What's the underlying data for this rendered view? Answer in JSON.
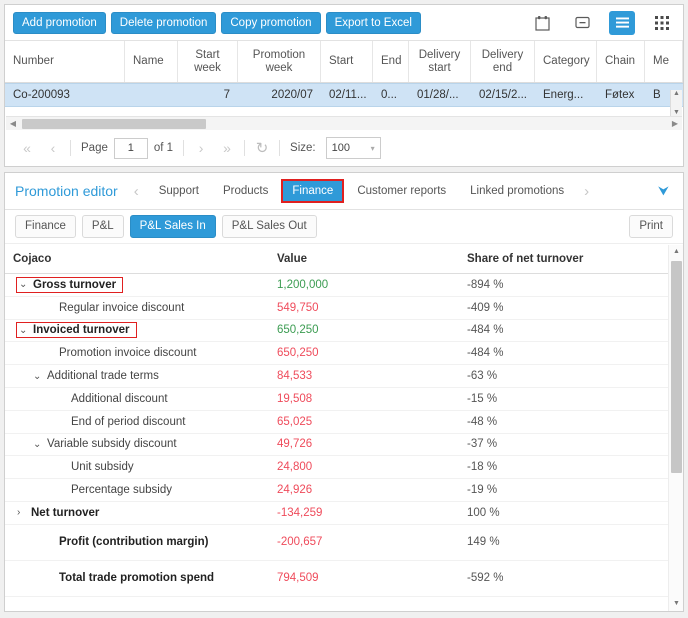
{
  "toolbar": {
    "buttons": [
      {
        "label": "Add promotion",
        "name": "add-promotion-button"
      },
      {
        "label": "Delete promotion",
        "name": "delete-promotion-button"
      },
      {
        "label": "Copy promotion",
        "name": "copy-promotion-button"
      },
      {
        "label": "Export to Excel",
        "name": "export-to-excel-button"
      }
    ],
    "icons": [
      {
        "name": "calendar-icon"
      },
      {
        "name": "collapse-box-icon"
      },
      {
        "name": "list-view-icon",
        "active": true
      },
      {
        "name": "grid-view-icon"
      }
    ]
  },
  "grid": {
    "columns": [
      "Number",
      "Name",
      "Start week",
      "Promotion week",
      "Start",
      "End",
      "Delivery start",
      "Delivery end",
      "Category",
      "Chain",
      "Me"
    ],
    "column_lines": [
      [
        "Number"
      ],
      [
        "Name"
      ],
      [
        "Start",
        "week"
      ],
      [
        "Promotion",
        "week"
      ],
      [
        "Start"
      ],
      [
        "End"
      ],
      [
        "Delivery",
        "start"
      ],
      [
        "Delivery",
        "end"
      ],
      [
        "Category"
      ],
      [
        "Chain"
      ],
      [
        "Me"
      ]
    ],
    "rows": [
      {
        "number": "Co-200093",
        "name": "",
        "start_week": "7",
        "promotion_week": "2020/07",
        "start": "02/11...",
        "end": "0...",
        "delivery_start": "01/28/...",
        "delivery_end": "02/15/2...",
        "category": "Energ...",
        "chain": "Føtex",
        "me": "B"
      }
    ]
  },
  "pager": {
    "first_label": "«",
    "prev_label": "‹",
    "next_label": "›",
    "last_label": "»",
    "refresh_label": "↻",
    "page_label": "Page",
    "page_value": "1",
    "of_label": "of 1",
    "size_label": "Size:",
    "size_value": "100"
  },
  "editor": {
    "title": "Promotion editor",
    "prev_arrow": "‹",
    "next_arrow": "›",
    "expand_icon": "ˇˇ",
    "tabs": [
      {
        "label": "Support",
        "selected": false
      },
      {
        "label": "Products",
        "selected": false
      },
      {
        "label": "Finance",
        "selected": true
      },
      {
        "label": "Customer reports",
        "selected": false
      },
      {
        "label": "Linked promotions",
        "selected": false
      }
    ],
    "sub_tabs": [
      {
        "label": "Finance",
        "active": false
      },
      {
        "label": "P&L",
        "active": false
      },
      {
        "label": "P&L Sales In",
        "active": true
      },
      {
        "label": "P&L Sales Out",
        "active": false
      }
    ],
    "print_label": "Print"
  },
  "finance_table": {
    "headers": [
      "Cojaco",
      "Value",
      "Share of net turnover"
    ],
    "rows": [
      {
        "label": "Gross turnover",
        "value": "1,200,000",
        "share": "-894 %",
        "twisty": "⌄",
        "indent": 0,
        "bold": true,
        "value_color": "pos",
        "highlight": true,
        "tall": false
      },
      {
        "label": "Regular invoice discount",
        "value": "549,750",
        "share": "-409 %",
        "twisty": "",
        "indent": 1,
        "bold": false,
        "value_color": "neg",
        "highlight": false,
        "tall": false
      },
      {
        "label": "Invoiced turnover",
        "value": "650,250",
        "share": "-484 %",
        "twisty": "⌄",
        "indent": 0,
        "bold": true,
        "value_color": "pos",
        "highlight": true,
        "tall": false
      },
      {
        "label": "Promotion invoice discount",
        "value": "650,250",
        "share": "-484 %",
        "twisty": "",
        "indent": 1,
        "bold": false,
        "value_color": "neg",
        "highlight": false,
        "tall": false
      },
      {
        "label": "Additional trade terms",
        "value": "84,533",
        "share": "-63 %",
        "twisty": "⌄",
        "indent": 2,
        "bold": false,
        "value_color": "neg",
        "highlight": false,
        "tall": false
      },
      {
        "label": "Additional discount",
        "value": "19,508",
        "share": "-15 %",
        "twisty": "",
        "indent": 3,
        "bold": false,
        "value_color": "neg",
        "highlight": false,
        "tall": false
      },
      {
        "label": "End of period discount",
        "value": "65,025",
        "share": "-48 %",
        "twisty": "",
        "indent": 3,
        "bold": false,
        "value_color": "neg",
        "highlight": false,
        "tall": false
      },
      {
        "label": "Variable subsidy discount",
        "value": "49,726",
        "share": "-37 %",
        "twisty": "⌄",
        "indent": 2,
        "bold": false,
        "value_color": "neg",
        "highlight": false,
        "tall": false
      },
      {
        "label": "Unit subsidy",
        "value": "24,800",
        "share": "-18 %",
        "twisty": "",
        "indent": 3,
        "bold": false,
        "value_color": "neg",
        "highlight": false,
        "tall": false
      },
      {
        "label": "Percentage subsidy",
        "value": "24,926",
        "share": "-19 %",
        "twisty": "",
        "indent": 3,
        "bold": false,
        "value_color": "neg",
        "highlight": false,
        "tall": false
      },
      {
        "label": "Net turnover",
        "value": "-134,259",
        "share": "100 %",
        "twisty": "›",
        "indent": 0,
        "bold": true,
        "value_color": "neg",
        "highlight": false,
        "tall": false
      },
      {
        "label": "Profit (contribution margin)",
        "value": "-200,657",
        "share": "149 %",
        "twisty": "",
        "indent": 1,
        "bold": true,
        "value_color": "neg",
        "highlight": false,
        "tall": true
      },
      {
        "label": "Total trade promotion spend",
        "value": "794,509",
        "share": "-592 %",
        "twisty": "",
        "indent": 1,
        "bold": true,
        "value_color": "neg",
        "highlight": false,
        "tall": true
      }
    ]
  },
  "colors": {
    "accent": "#2f9ad8",
    "positive": "#3c9c52",
    "negative": "#ef4b5b",
    "highlight": "#e02020",
    "row_selected": "#cfe3f5"
  }
}
